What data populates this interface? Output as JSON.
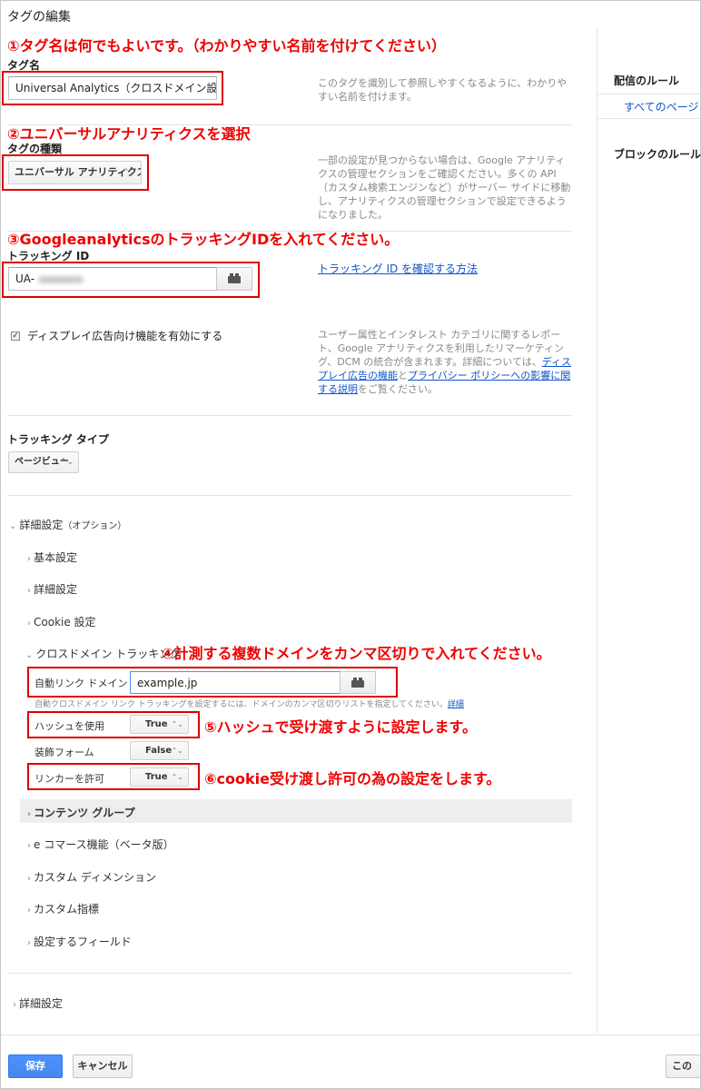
{
  "title": "タグの編集",
  "annotations": {
    "a1": "①タグ名は何でもよいです。（わかりやすい名前を付けてください）",
    "a2": "②ユニバーサルアナリティクスを選択",
    "a3": "③GoogleanalyticsのトラッキングIDを入れてください。",
    "a4": "④計測する複数ドメインをカンマ区切りで入れてください。",
    "a5": "⑤ハッシュで受け渡すように設定します。",
    "a6": "⑥cookie受け渡し許可の為の設定をします。"
  },
  "tag_name": {
    "label": "タグ名",
    "value": "Universal Analytics（クロスドメイン設定）",
    "help": "このタグを識別して参照しやすくなるように、わかりやすい名前を付けます。"
  },
  "tag_type": {
    "label": "タグの種類",
    "value": "ユニバーサル アナリティクス",
    "help": "一部の設定が見つからない場合は、Google アナリティクスの管理セクションをご確認ください。多くの API（カスタム検索エンジンなど）がサーバー サイドに移動し、アナリティクスの管理セクションで設定できるようになりました。"
  },
  "tracking_id": {
    "label": "トラッキング ID",
    "value": "UA-",
    "help_link": "トラッキング ID を確認する方法"
  },
  "display_ads": {
    "label": "ディスプレイ広告向け機能を有効にする",
    "help_1": "ユーザー属性とインタレスト カテゴリに関するレポート、Google アナリティクスを利用したリマーケティング、DCM の統合が含まれます。詳細については、",
    "link_1": "ディスプレイ広告の機能",
    "help_2": "と",
    "link_2": "プライバシー ポリシーへの影響に関する説明",
    "help_3": "をご覧ください。"
  },
  "tracking_type": {
    "label": "トラッキング タイプ",
    "value": "ページビュー"
  },
  "advanced": {
    "label": "詳細設定",
    "optional": "（オプション）",
    "items": {
      "basic": "基本設定",
      "detail": "詳細設定",
      "cookie": "Cookie 設定",
      "cross": "クロスドメイン トラッキング",
      "content_group": "コンテンツ グループ",
      "ecommerce": "e コマース機能（ベータ版）",
      "custom_dim": "カスタム ディメンション",
      "custom_metric": "カスタム指標",
      "fields": "設定するフィールド"
    }
  },
  "cross_domain": {
    "auto_link_label": "自動リンク ドメイン",
    "auto_link_value": "example.jp",
    "help": "自動クロスドメイン リンク トラッキングを設定するには、ドメインのカンマ区切りリストを指定してください。",
    "help_link": "詳細",
    "use_hash_label": "ハッシュを使用",
    "use_hash_value": "True",
    "decorate_forms_label": "装飾フォーム",
    "decorate_forms_value": "False",
    "allow_linker_label": "リンカーを許可",
    "allow_linker_value": "True"
  },
  "bottom_advanced": "詳細設定",
  "right_panel": {
    "firing_rules": "配信のルール",
    "all_pages": "すべてのページ",
    "blocking_rules": "ブロックのルール"
  },
  "buttons": {
    "save": "保存",
    "cancel": "キャンセル",
    "right": "この"
  }
}
